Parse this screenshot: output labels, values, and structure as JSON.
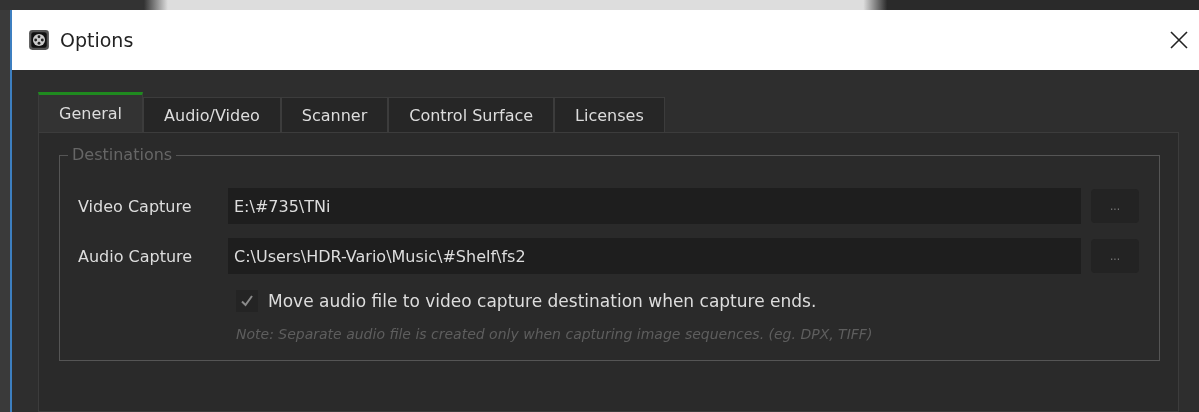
{
  "window": {
    "title": "Options"
  },
  "tabs": [
    {
      "label": "General",
      "selected": true
    },
    {
      "label": "Audio/Video",
      "selected": false
    },
    {
      "label": "Scanner",
      "selected": false
    },
    {
      "label": "Control Surface",
      "selected": false
    },
    {
      "label": "Licenses",
      "selected": false
    }
  ],
  "group": {
    "title": "Destinations",
    "fields": [
      {
        "label": "Video Capture",
        "value": "E:\\#735\\TNi",
        "browse": "..."
      },
      {
        "label": "Audio Capture",
        "value": "C:\\Users\\HDR-Vario\\Music\\#Shelf\\fs2",
        "browse": "..."
      }
    ],
    "checkbox": {
      "label": "Move audio file to video capture destination when capture ends.",
      "checked": true
    },
    "note": "Note: Separate audio file is created only when capturing image sequences. (eg. DPX, TIFF)"
  }
}
